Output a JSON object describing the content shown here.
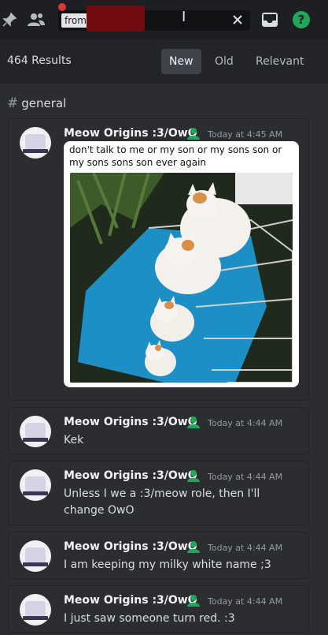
{
  "search": {
    "query_prefix": "from:",
    "clear_icon": "close-icon"
  },
  "results": {
    "count_label": "464 Results",
    "sort": [
      "New",
      "Old",
      "Relevant"
    ],
    "active_sort": "New"
  },
  "channel": {
    "hash": "#",
    "name": "general"
  },
  "messages": [
    {
      "author": "Meow Origins :3/OwO",
      "time": "Today at 4:45 AM",
      "attachment_caption": "don't talk to me or my son or my sons son or my sons sons son ever again"
    },
    {
      "author": "Meow Origins :3/OwO",
      "time": "Today at 4:44 AM",
      "text": "Kek"
    },
    {
      "author": "Meow Origins :3/OwO",
      "time": "Today at 4:44 AM",
      "text": "Unless I we a :3/meow role, then I'll change OwO"
    },
    {
      "author": "Meow Origins :3/OwO",
      "time": "Today at 4:44 AM",
      "text": "I am keeping my milky white name ;3"
    },
    {
      "author": "Meow Origins :3/OwO",
      "time": "Today at 4:44 AM",
      "text": "I just saw someone turn red. :3"
    }
  ],
  "colors": {
    "accent_green": "#23a55a",
    "redaction": "#700c10",
    "background": "#2b2d31"
  }
}
